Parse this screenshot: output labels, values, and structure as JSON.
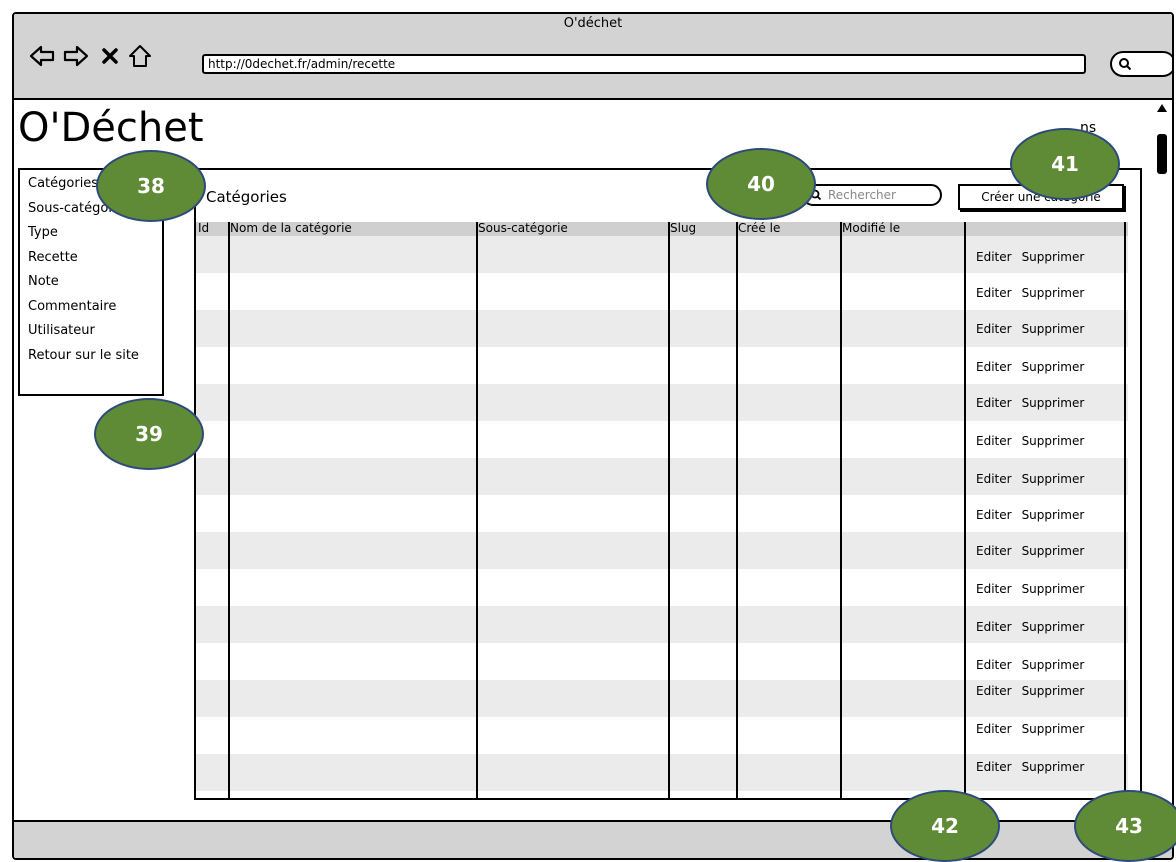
{
  "window": {
    "title": "O'déchet"
  },
  "browser": {
    "url": "http://0dechet.fr/admin/recette"
  },
  "page": {
    "logo": "O'Déchet",
    "corner_text": "ns"
  },
  "sidebar": {
    "items": [
      {
        "label": "Catégories"
      },
      {
        "label": "Sous-catégories"
      },
      {
        "label": "Type"
      },
      {
        "label": "Recette"
      },
      {
        "label": "Note"
      },
      {
        "label": "Commentaire"
      },
      {
        "label": "Utilisateur"
      },
      {
        "label": "Retour sur le site"
      }
    ]
  },
  "panel": {
    "title": "Catégories",
    "search_placeholder": "Rechercher",
    "create_button": "Créer une catégorie"
  },
  "table": {
    "columns": [
      "Id",
      "Nom de la catégorie",
      "Sous-catégorie",
      "Slug",
      "Créé le",
      "Modifié le",
      ""
    ],
    "edit_label": "Editer",
    "delete_label": "Supprimer",
    "row_count": 15
  },
  "callouts": [
    "38",
    "39",
    "40",
    "41",
    "42",
    "43"
  ]
}
